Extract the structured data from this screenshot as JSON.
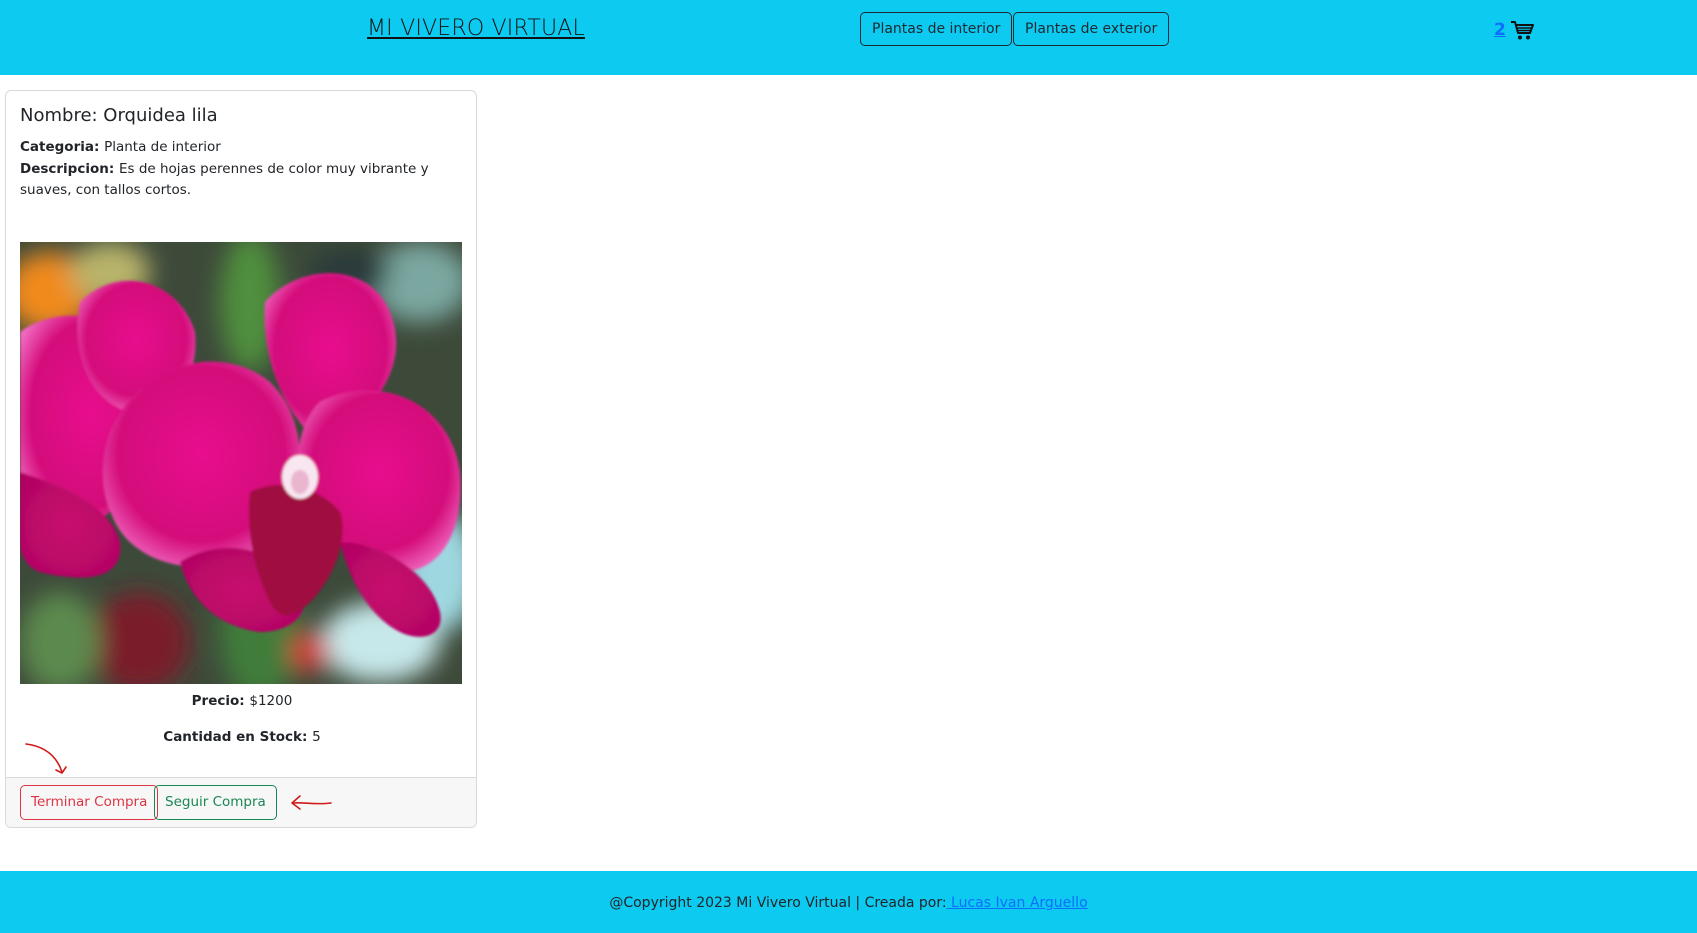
{
  "header": {
    "brand": "MI VIVERO VIRTUAL",
    "nav": {
      "interior": "Plantas de interior",
      "exterior": "Plantas de exterior"
    },
    "cart": {
      "count": "2",
      "icon": "shopping-cart-icon"
    }
  },
  "product": {
    "title": "Nombre: Orquidea lila",
    "category_label": "Categoria:",
    "category": "Planta de interior",
    "description_label": "Descripcion:",
    "description": "Es de hojas perennes de color muy vibrante y suaves, con tallos cortos.",
    "price_label": "Precio:",
    "price": "$1200",
    "stock_label": "Cantidad en Stock:",
    "stock": "5",
    "image": "pink-orchid-photo"
  },
  "actions": {
    "finish": "Terminar Compra",
    "continue": "Seguir Compra"
  },
  "annotations": [
    "curved-arrow-icon",
    "left-arrow-icon"
  ],
  "footer": {
    "text": "@Copyright 2023 Mi Vivero Virtual | Creada por:",
    "author": "Lucas Ivan Arguello"
  },
  "colors": {
    "header_bg": "#0dcaf0",
    "danger": "#dc3545",
    "success": "#198754",
    "link": "#0d6efd",
    "annotation": "#d11a1a"
  }
}
